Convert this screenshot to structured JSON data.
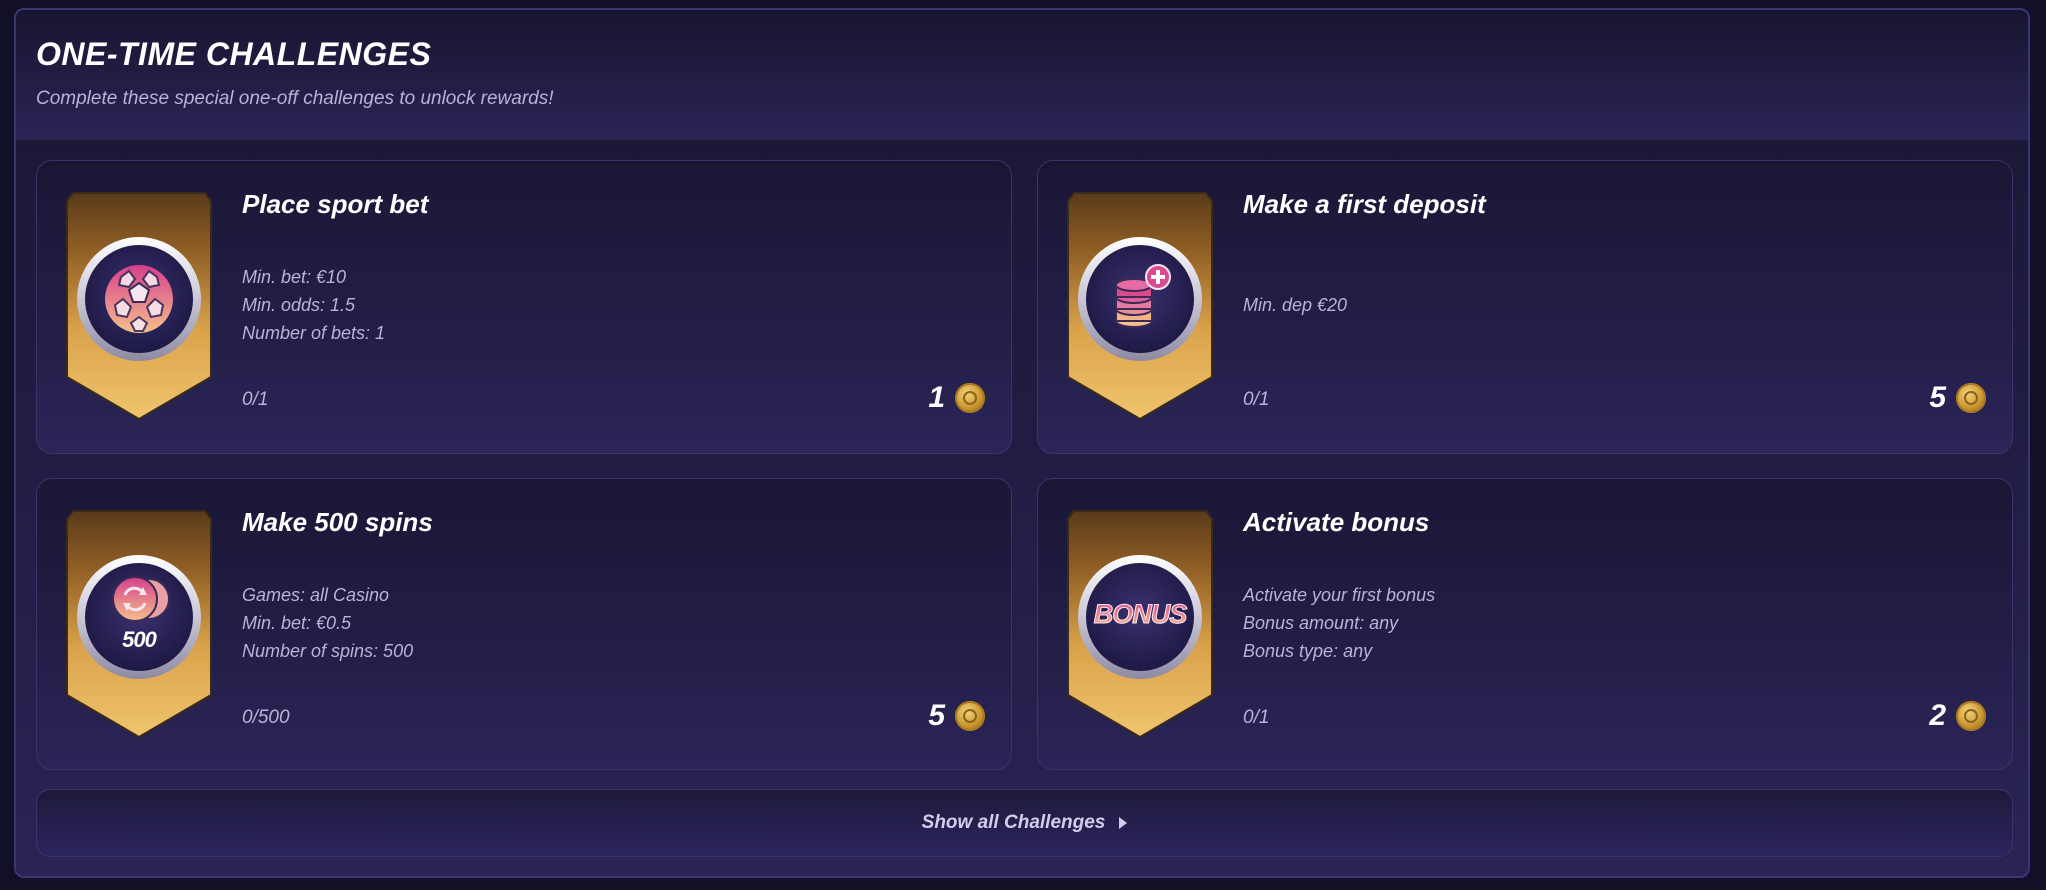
{
  "header": {
    "title": "ONE-TIME CHALLENGES",
    "subtitle": "Complete these special one-off challenges to unlock rewards!"
  },
  "challenges": [
    {
      "title": "Place sport bet",
      "icon": "soccer-ball-icon",
      "requirements": [
        "Min. bet: €10",
        "Min. odds: 1.5",
        "Number of bets: 1"
      ],
      "progress": "0/1",
      "reward": "1"
    },
    {
      "title": "Make a first deposit",
      "icon": "coin-stack-plus-icon",
      "requirements": [
        "Min. dep €20"
      ],
      "progress": "0/1",
      "reward": "5"
    },
    {
      "title": "Make 500 spins",
      "icon": "spins-500-icon",
      "icon_text": "500",
      "requirements": [
        "Games: all Casino",
        "Min. bet: €0.5",
        "Number of spins: 500"
      ],
      "progress": "0/500",
      "reward": "5"
    },
    {
      "title": "Activate bonus",
      "icon": "bonus-icon",
      "icon_text": "BONUS",
      "requirements": [
        "Activate your first bonus",
        "Bonus amount: any",
        "Bonus type: any"
      ],
      "progress": "0/1",
      "reward": "2"
    }
  ],
  "footer": {
    "show_all_label": "Show all Challenges"
  },
  "colors": {
    "background": "#121028",
    "panel_border": "#3c3672",
    "badge_gold": "#d9a24a",
    "icon_pink": "#d94a8f",
    "icon_peach": "#f0b38a",
    "text_muted": "#b9b3d8"
  }
}
